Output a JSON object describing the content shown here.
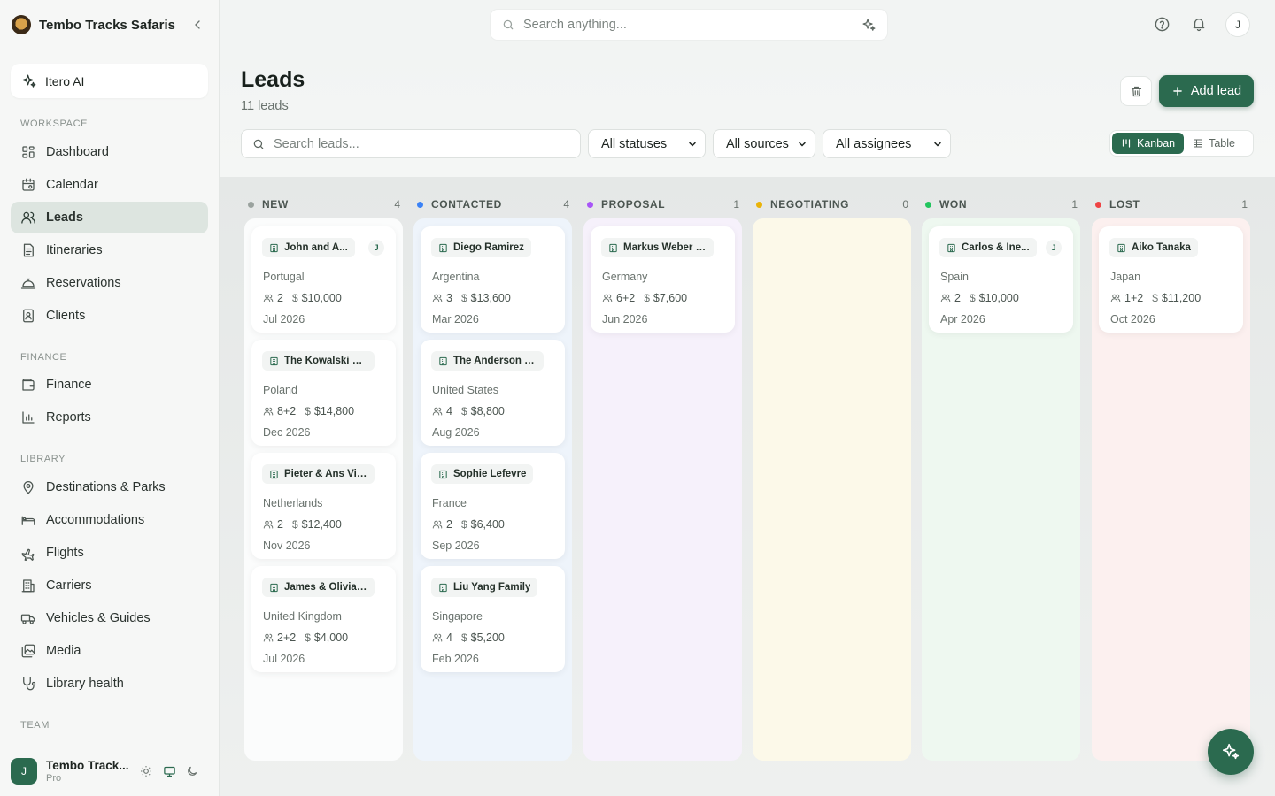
{
  "brand": {
    "name": "Tembo Tracks Safaris"
  },
  "ai": {
    "label": "Itero AI"
  },
  "sidebar": {
    "sections": {
      "workspace": "WORKSPACE",
      "finance": "FINANCE",
      "library": "LIBRARY",
      "team": "TEAM"
    },
    "items": [
      {
        "label": "Dashboard",
        "icon": "dashboard-icon"
      },
      {
        "label": "Calendar",
        "icon": "calendar-icon"
      },
      {
        "label": "Leads",
        "icon": "users-icon",
        "active": true
      },
      {
        "label": "Itineraries",
        "icon": "document-icon"
      },
      {
        "label": "Reservations",
        "icon": "bell-service-icon"
      },
      {
        "label": "Clients",
        "icon": "contact-icon"
      },
      {
        "label": "Finance",
        "icon": "wallet-icon"
      },
      {
        "label": "Reports",
        "icon": "bar-chart-icon"
      },
      {
        "label": "Destinations & Parks",
        "icon": "map-pin-icon"
      },
      {
        "label": "Accommodations",
        "icon": "bed-icon"
      },
      {
        "label": "Flights",
        "icon": "plane-icon"
      },
      {
        "label": "Carriers",
        "icon": "building-icon"
      },
      {
        "label": "Vehicles & Guides",
        "icon": "vehicle-icon"
      },
      {
        "label": "Media",
        "icon": "image-icon"
      },
      {
        "label": "Library health",
        "icon": "stethoscope-icon"
      }
    ]
  },
  "profile": {
    "initial": "J",
    "name": "Tembo Track...",
    "plan": "Pro"
  },
  "topbar": {
    "search_placeholder": "Search anything...",
    "avatar_initial": "J"
  },
  "page": {
    "title": "Leads",
    "count": "11 leads",
    "add_label": "Add lead"
  },
  "filters": {
    "search_placeholder": "Search leads...",
    "status": "All statuses",
    "source": "All sources",
    "assignee": "All assignees"
  },
  "view": {
    "kanban": "Kanban",
    "table": "Table",
    "selected": "Kanban"
  },
  "colors": {
    "accent": "#2b6a4f"
  },
  "columns": [
    {
      "name": "NEW",
      "count": "4",
      "dot": "#9aa29e",
      "bg": "#fbfcfc",
      "cards": [
        {
          "name": "John and A...",
          "assignee": "J",
          "country": "Portugal",
          "pax": "2",
          "budget": "$10,000",
          "date": "Jul 2026"
        },
        {
          "name": "The Kowalski Reu...",
          "country": "Poland",
          "pax": "8+2",
          "budget": "$14,800",
          "date": "Dec 2026"
        },
        {
          "name": "Pieter & Ans Visser",
          "country": "Netherlands",
          "pax": "2",
          "budget": "$12,400",
          "date": "Nov 2026"
        },
        {
          "name": "James & Olivia H...",
          "country": "United Kingdom",
          "pax": "2+2",
          "budget": "$4,000",
          "date": "Jul 2026"
        }
      ]
    },
    {
      "name": "CONTACTED",
      "count": "4",
      "dot": "#3b82f6",
      "bg": "#eef4fb",
      "cards": [
        {
          "name": "Diego Ramirez",
          "country": "Argentina",
          "pax": "3",
          "budget": "$13,600",
          "date": "Mar 2026"
        },
        {
          "name": "The Anderson Fa...",
          "country": "United States",
          "pax": "4",
          "budget": "$8,800",
          "date": "Aug 2026"
        },
        {
          "name": "Sophie Lefevre",
          "country": "France",
          "pax": "2",
          "budget": "$6,400",
          "date": "Sep 2026"
        },
        {
          "name": "Liu Yang Family",
          "country": "Singapore",
          "pax": "4",
          "budget": "$5,200",
          "date": "Feb 2026"
        }
      ]
    },
    {
      "name": "PROPOSAL",
      "count": "1",
      "dot": "#a855f7",
      "bg": "#f6f1fb",
      "cards": [
        {
          "name": "Markus Weber Gr...",
          "country": "Germany",
          "pax": "6+2",
          "budget": "$7,600",
          "date": "Jun 2026"
        }
      ]
    },
    {
      "name": "NEGOTIATING",
      "count": "0",
      "dot": "#eab308",
      "bg": "#fcf9e9",
      "cards": []
    },
    {
      "name": "WON",
      "count": "1",
      "dot": "#22c55e",
      "bg": "#eef8f0",
      "cards": [
        {
          "name": "Carlos & Ine...",
          "assignee": "J",
          "country": "Spain",
          "pax": "2",
          "budget": "$10,000",
          "date": "Apr 2026"
        }
      ]
    },
    {
      "name": "LOST",
      "count": "1",
      "dot": "#ef4444",
      "bg": "#fcf0ef",
      "cards": [
        {
          "name": "Aiko Tanaka",
          "country": "Japan",
          "pax": "1+2",
          "budget": "$11,200",
          "date": "Oct 2026"
        }
      ]
    }
  ]
}
